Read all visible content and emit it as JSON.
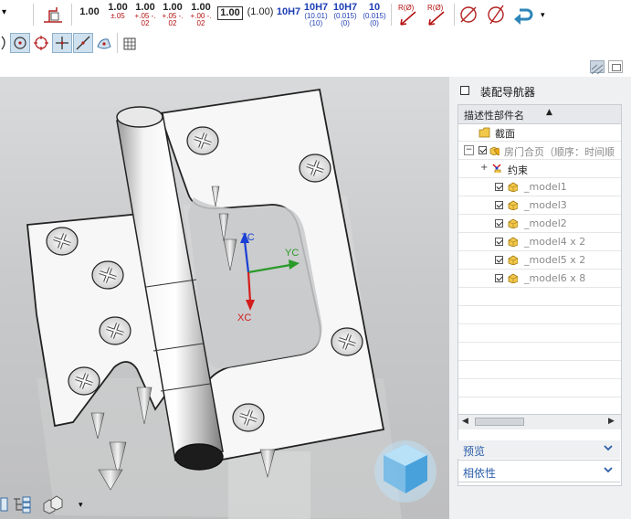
{
  "toolbar": {
    "tolerances": [
      {
        "main": "1.00",
        "sub": ""
      },
      {
        "main": "1.00",
        "sub": "±.05"
      },
      {
        "main": "1.00",
        "sub": "+.05 -.02"
      },
      {
        "main": "1.00",
        "sub": "+.05 -.02"
      },
      {
        "main": "1.00",
        "sub": "+.00 -.02"
      },
      {
        "main": "1.00",
        "sub": ""
      },
      {
        "main": "(1.00)",
        "sub": ""
      },
      {
        "main": "10H7",
        "sub": ""
      },
      {
        "main": "10H7",
        "sub": "(10.01) (10)"
      },
      {
        "main": "10H7",
        "sub": "(0.015) (0)"
      },
      {
        "main": "10",
        "sub": "(0.015) (0)"
      }
    ],
    "radius_labels": [
      "R(Ø)",
      "R(Ø)"
    ]
  },
  "viewport": {
    "axis_labels": {
      "zc": "ZC",
      "yc": "YC",
      "xc": "XC"
    },
    "colors": {
      "zc": "#1a3fd6",
      "yc": "#2a9a2a",
      "xc": "#d41c1c"
    }
  },
  "navigator": {
    "title": "装配导航器",
    "column_header": "描述性部件名",
    "rows": [
      {
        "label": "截面",
        "icon": "folder-icon"
      },
      {
        "label": "房门合页（顺序：时间顺",
        "icon": "assembly-icon"
      },
      {
        "label": "约束",
        "icon": "constraint-icon"
      },
      {
        "label": "_model1",
        "icon": "part-icon"
      },
      {
        "label": "_model3",
        "icon": "part-icon"
      },
      {
        "label": "_model2",
        "icon": "part-icon"
      },
      {
        "label": "_model4 x 2",
        "icon": "part-icon"
      },
      {
        "label": "_model5 x 2",
        "icon": "part-icon"
      },
      {
        "label": "_model6 x 8",
        "icon": "part-icon"
      }
    ],
    "sections": [
      "预览",
      "相依性"
    ]
  }
}
